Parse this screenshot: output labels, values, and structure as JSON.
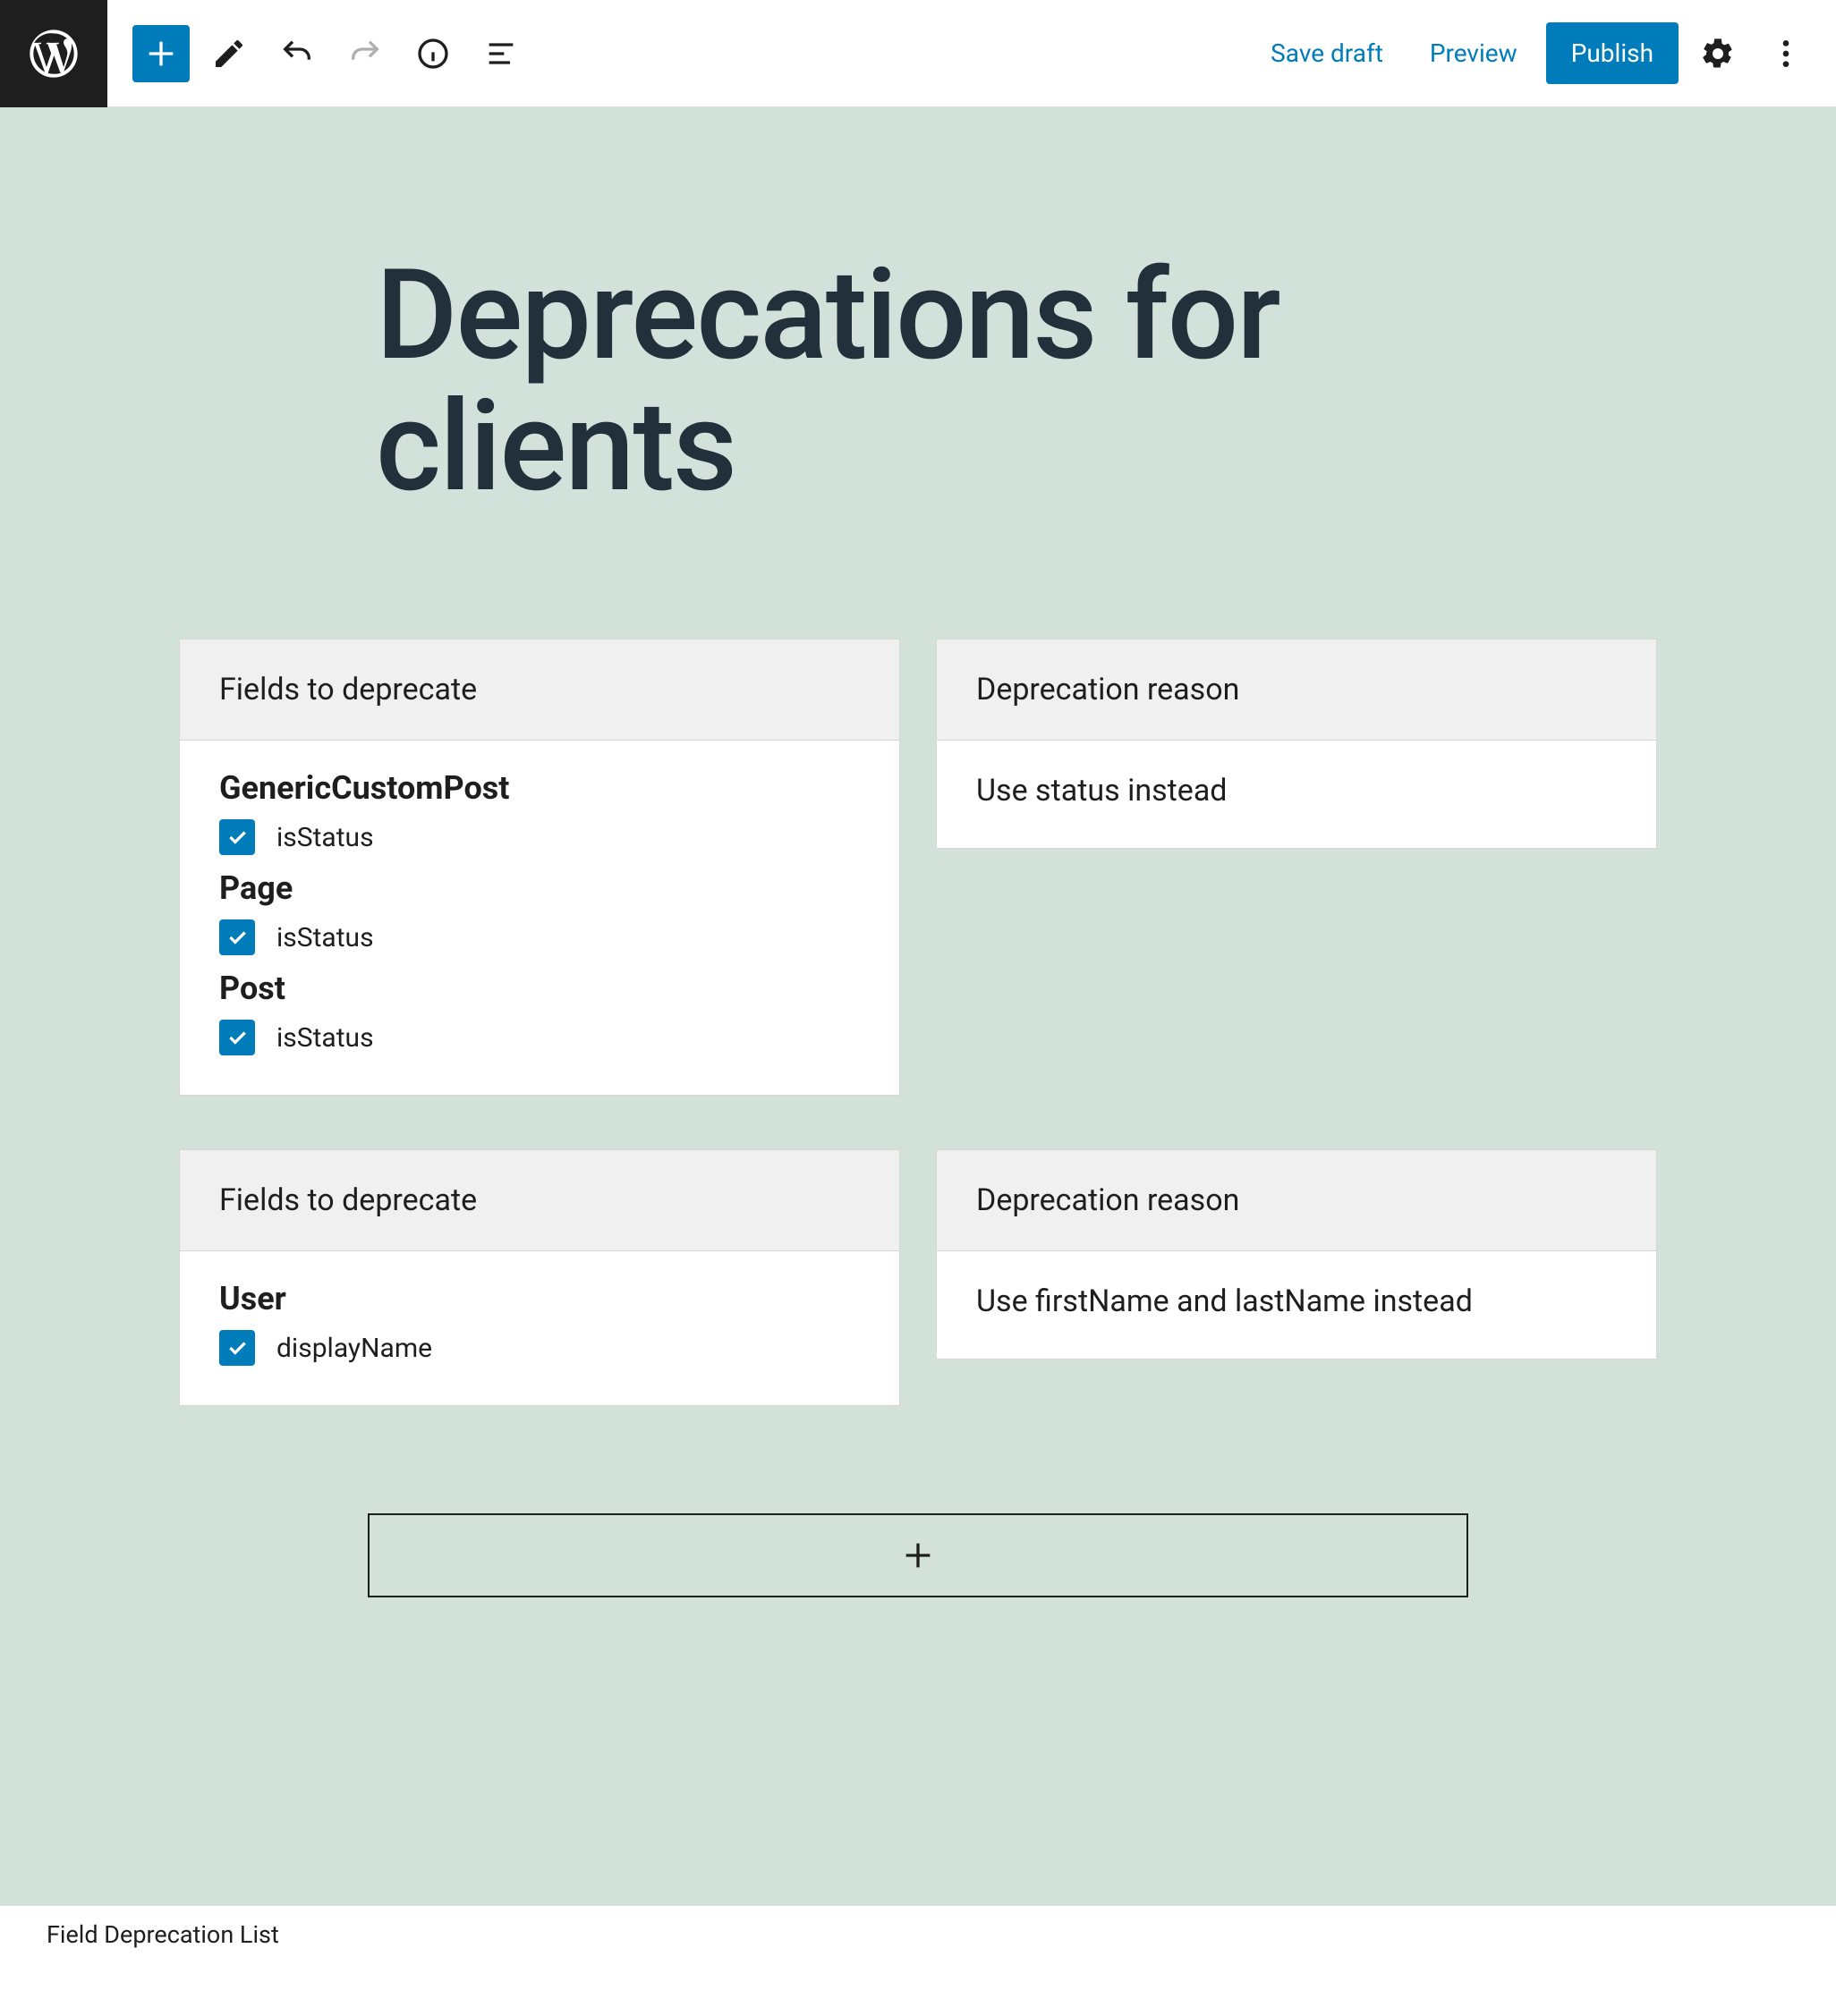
{
  "toolbar": {
    "save_draft": "Save draft",
    "preview": "Preview",
    "publish": "Publish"
  },
  "page": {
    "title": "Deprecations for clients"
  },
  "cardHeaders": {
    "fields": "Fields to deprecate",
    "reason": "Deprecation reason"
  },
  "blocks": [
    {
      "reason": "Use status instead",
      "types": [
        {
          "name": "GenericCustomPost",
          "fields": [
            "isStatus"
          ]
        },
        {
          "name": "Page",
          "fields": [
            "isStatus"
          ]
        },
        {
          "name": "Post",
          "fields": [
            "isStatus"
          ]
        }
      ]
    },
    {
      "reason": "Use firstName and lastName instead",
      "types": [
        {
          "name": "User",
          "fields": [
            "displayName"
          ]
        }
      ]
    }
  ],
  "breadcrumb": "Field Deprecation List"
}
